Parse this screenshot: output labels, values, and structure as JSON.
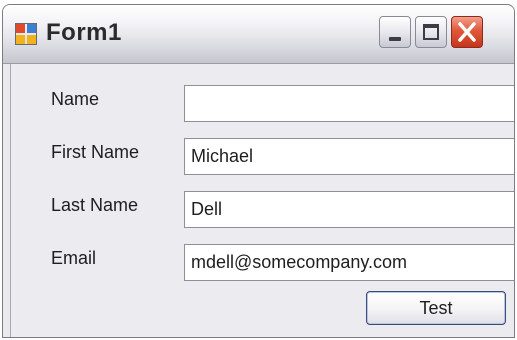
{
  "window": {
    "title": "Form1",
    "title_icon": "form-icon",
    "controls": [
      "minimize-icon",
      "maximize-icon",
      "close-icon"
    ]
  },
  "form": {
    "fields": [
      {
        "label": "Name",
        "value": ""
      },
      {
        "label": "First Name",
        "value": "Michael"
      },
      {
        "label": "Last Name",
        "value": "Dell"
      },
      {
        "label": "Email",
        "value": "mdell@somecompany.com"
      }
    ],
    "test_button_label": "Test"
  },
  "colors": {
    "close_button": "#d94f33",
    "title_text": "#2b2b2b",
    "client_background": "#ecebf0"
  }
}
